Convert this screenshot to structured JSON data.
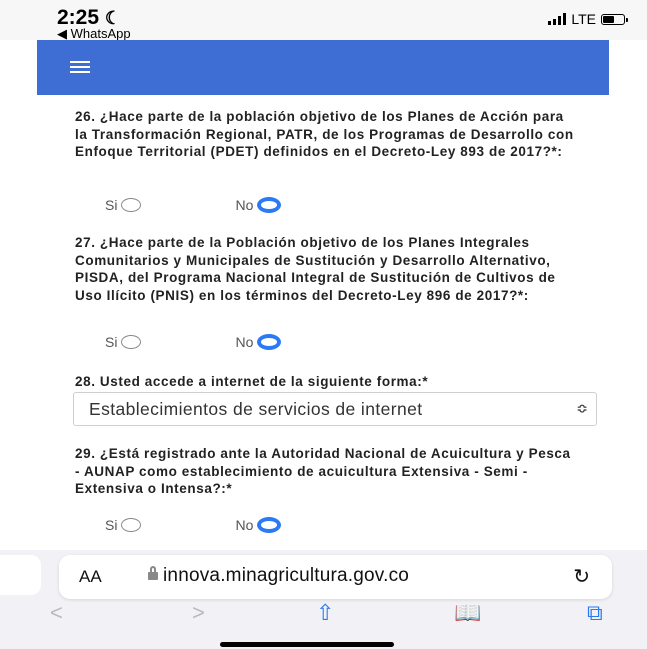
{
  "status": {
    "time": "2:25",
    "back_app": "◀ WhatsApp",
    "network": "LTE"
  },
  "questions": [
    {
      "text": "26. ¿Hace parte de la población objetivo de los Planes de Acción para la Transformación Regional, PATR, de los Programas de Desarrollo con Enfoque Territorial (PDET) definidos en el Decreto-Ley 893 de 2017?*:",
      "yes_label": "Si",
      "no_label": "No",
      "selected": "No"
    },
    {
      "text": "27. ¿Hace parte de la Población objetivo de los Planes Integrales Comunitarios y Municipales de Sustitución y Desarrollo Alternativo, PISDA, del Programa Nacional Integral de Sustitución de Cultivos de Uso Ilícito (PNIS) en los términos del Decreto-Ley 896 de 2017?*:",
      "yes_label": "Si",
      "no_label": "No",
      "selected": "No"
    },
    {
      "text": "28. Usted accede a internet de la siguiente forma:*",
      "select_value": "Establecimientos de servicios de internet"
    },
    {
      "text": "29. ¿Está registrado ante la Autoridad Nacional de Acuicultura y Pesca - AUNAP como establecimiento de acuicultura Extensiva - Semi - Extensiva o Intensa?:*",
      "yes_label": "Si",
      "no_label": "No",
      "selected": "No"
    }
  ],
  "browser": {
    "text_size_label": "AA",
    "url": "innova.minagricultura.gov.co"
  },
  "colors": {
    "navbar": "#3e6ed4",
    "radio_selected": "#2a7af5",
    "ios_blue": "#2a7af5"
  },
  "icons": [
    "moon-icon",
    "signal-icon",
    "battery-icon",
    "hamburger-menu-icon",
    "lock-icon",
    "reload-icon",
    "back-icon",
    "forward-icon",
    "share-icon",
    "bookmarks-icon",
    "tabs-icon"
  ]
}
